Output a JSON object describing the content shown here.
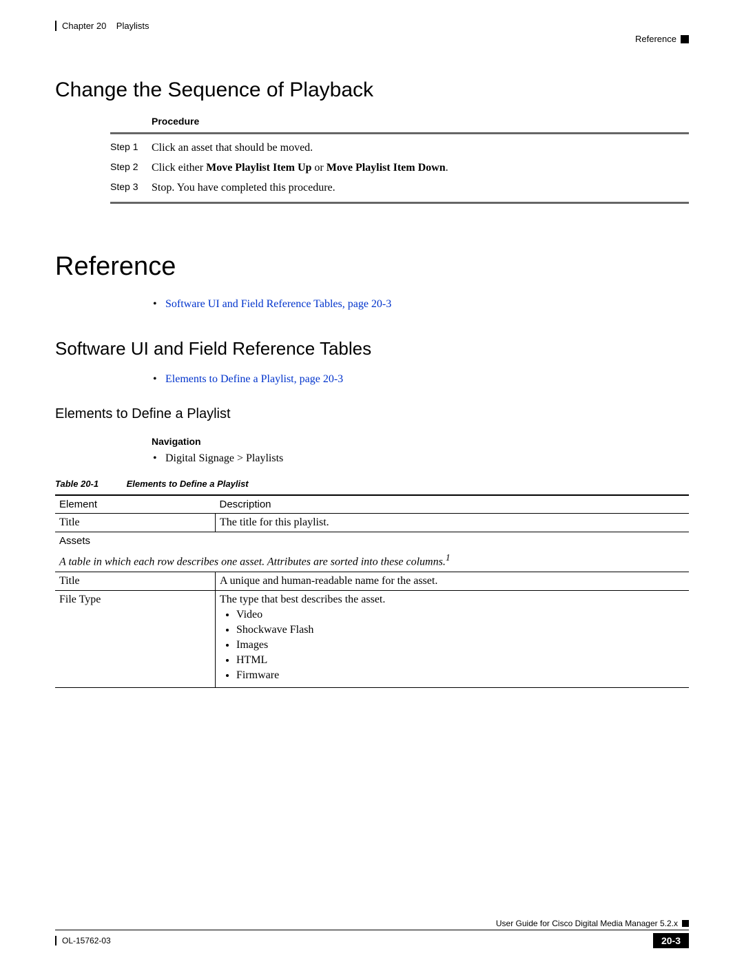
{
  "header": {
    "chapter": "Chapter 20",
    "chapter_title": "Playlists",
    "section_ref": "Reference"
  },
  "h2_change": "Change the Sequence of Playback",
  "procedure_label": "Procedure",
  "steps": [
    {
      "label": "Step 1",
      "text": "Click an asset that should be moved."
    },
    {
      "label": "Step 2",
      "prefix": "Click either ",
      "bold1": "Move Playlist Item Up",
      "mid": " or ",
      "bold2": "Move Playlist Item Down",
      "suffix": "."
    },
    {
      "label": "Step 3",
      "text": "Stop. You have completed this procedure."
    }
  ],
  "h1_reference": "Reference",
  "link1": "Software UI and Field Reference Tables, page 20-3",
  "h3_software": "Software UI and Field Reference Tables",
  "link2": "Elements to Define a Playlist, page 20-3",
  "h4_elements": "Elements to Define a Playlist",
  "nav_label": "Navigation",
  "nav_path": "Digital Signage > Playlists",
  "table_caption_num": "Table 20-1",
  "table_caption_title": "Elements to Define a Playlist",
  "table": {
    "headers": {
      "c1": "Element",
      "c2": "Description"
    },
    "row1": {
      "c1": "Title",
      "c2": "The title for this playlist."
    },
    "assets_label": "Assets",
    "assets_note": "A table in which each row describes one asset. Attributes are sorted into these columns.",
    "assets_note_sup": "1",
    "row_title": {
      "c1": "Title",
      "c2": "A unique and human-readable name for the asset."
    },
    "row_filetype": {
      "c1": "File Type",
      "c2": "The type that best describes the asset.",
      "items": [
        "Video",
        "Shockwave Flash",
        "Images",
        "HTML",
        "Firmware"
      ]
    }
  },
  "footer": {
    "guide": "User Guide for Cisco Digital Media Manager 5.2.x",
    "doc": "OL-15762-03",
    "page": "20-3"
  }
}
